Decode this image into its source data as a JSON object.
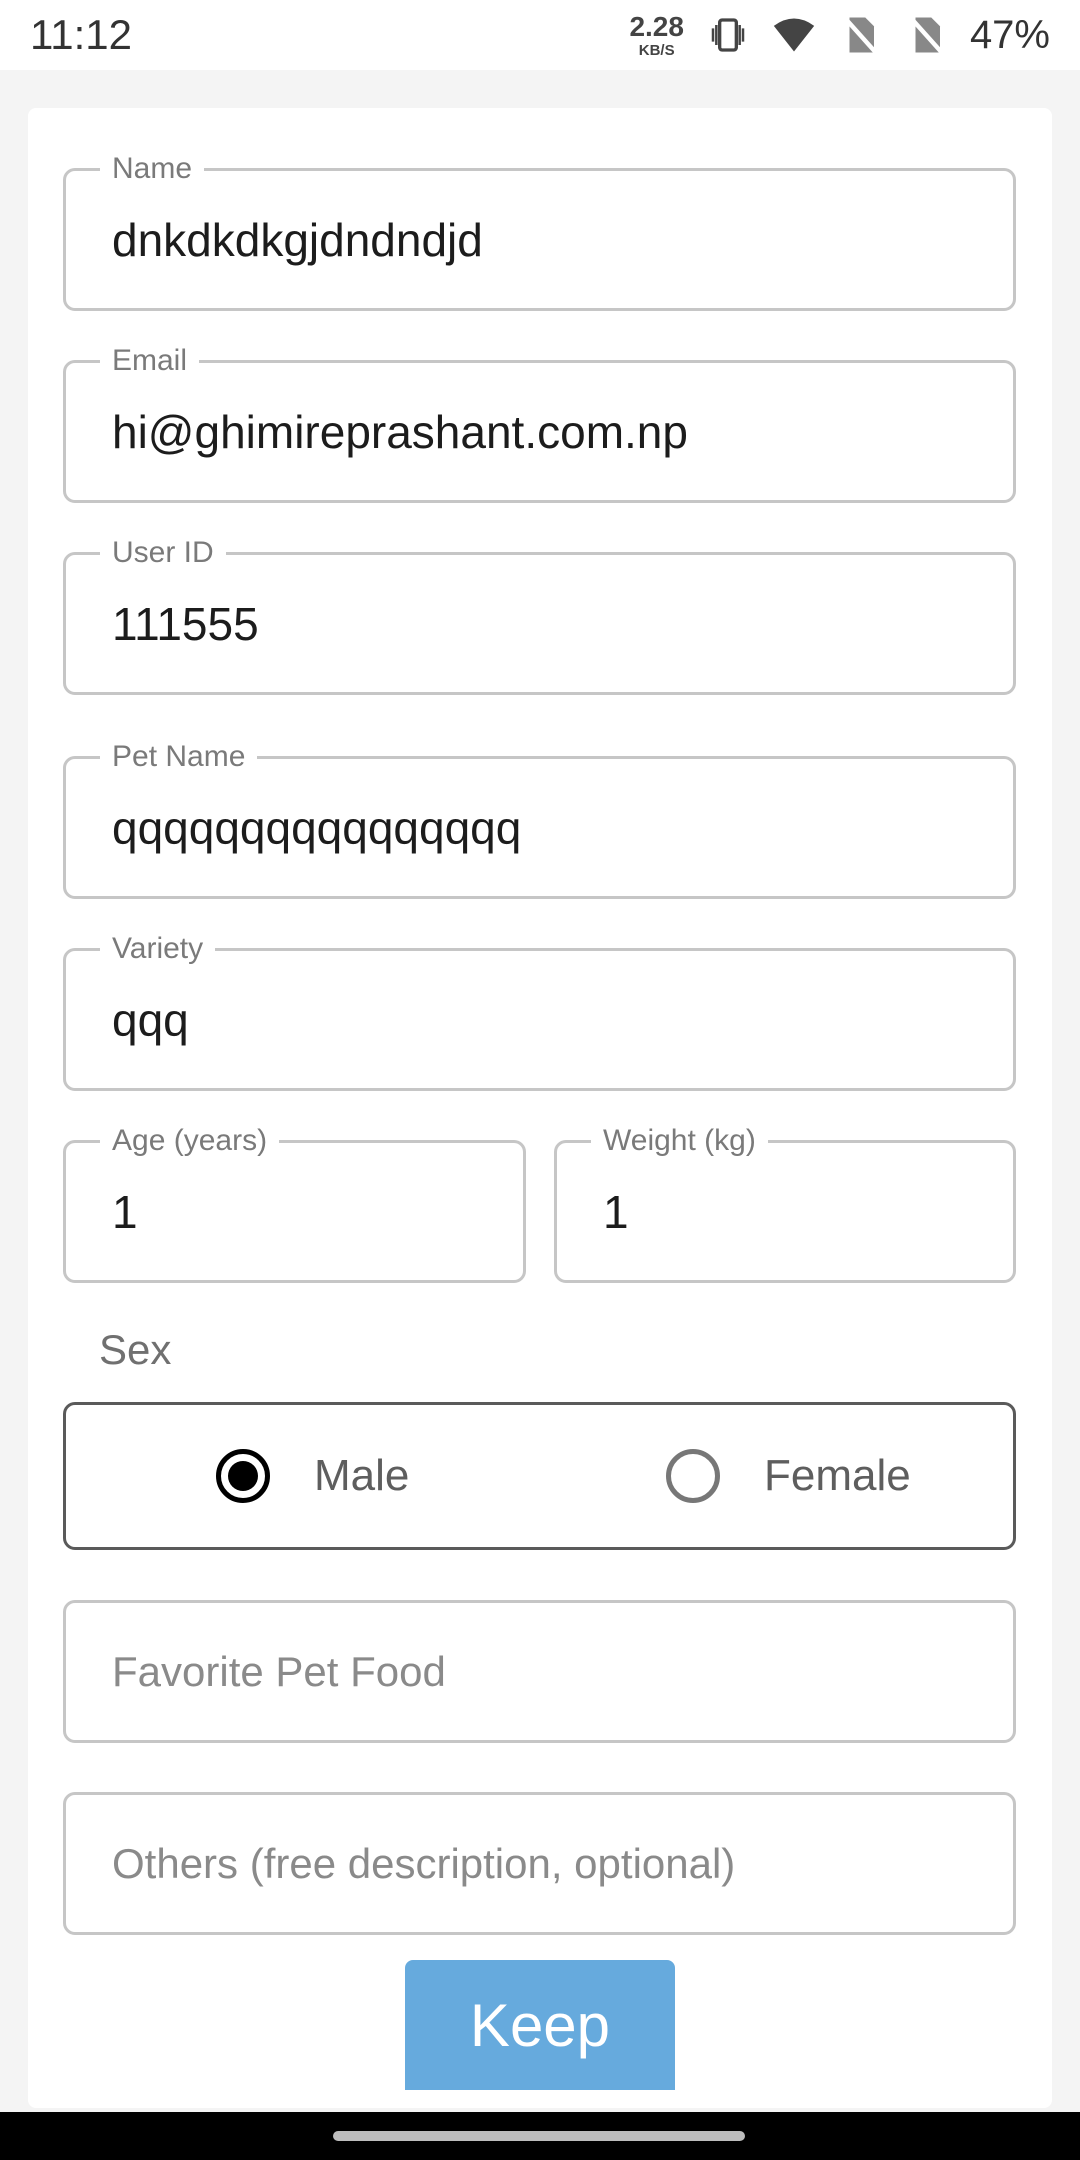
{
  "status_bar": {
    "time": "11:12",
    "net_speed_value": "2.28",
    "net_speed_unit": "KB/S",
    "icons": [
      "vibrate-icon",
      "wifi-icon",
      "no-sim-icon",
      "no-sim-icon"
    ],
    "battery": "47%"
  },
  "form": {
    "name": {
      "label": "Name",
      "value": "dnkdkdkgjdndndjd"
    },
    "email": {
      "label": "Email",
      "value": "hi@ghimireprashant.com.np"
    },
    "user_id": {
      "label": "User ID",
      "value": "111555"
    },
    "pet_name": {
      "label": "Pet Name",
      "value": "qqqqqqqqqqqqqqqq"
    },
    "variety": {
      "label": "Variety",
      "value": "qqq"
    },
    "age": {
      "label": "Age (years)",
      "value": "1"
    },
    "weight": {
      "label": "Weight (kg)",
      "value": "1"
    },
    "sex": {
      "label": "Sex",
      "options": [
        {
          "label": "Male",
          "checked": true
        },
        {
          "label": "Female",
          "checked": false
        }
      ]
    },
    "favorite_food": {
      "placeholder": "Favorite Pet Food"
    },
    "others": {
      "placeholder": "Others (free description, optional)"
    },
    "keep_label": "Keep"
  },
  "colors": {
    "button": "#66aadd",
    "border": "#c6c6c6",
    "nav_bar": "#000000"
  }
}
